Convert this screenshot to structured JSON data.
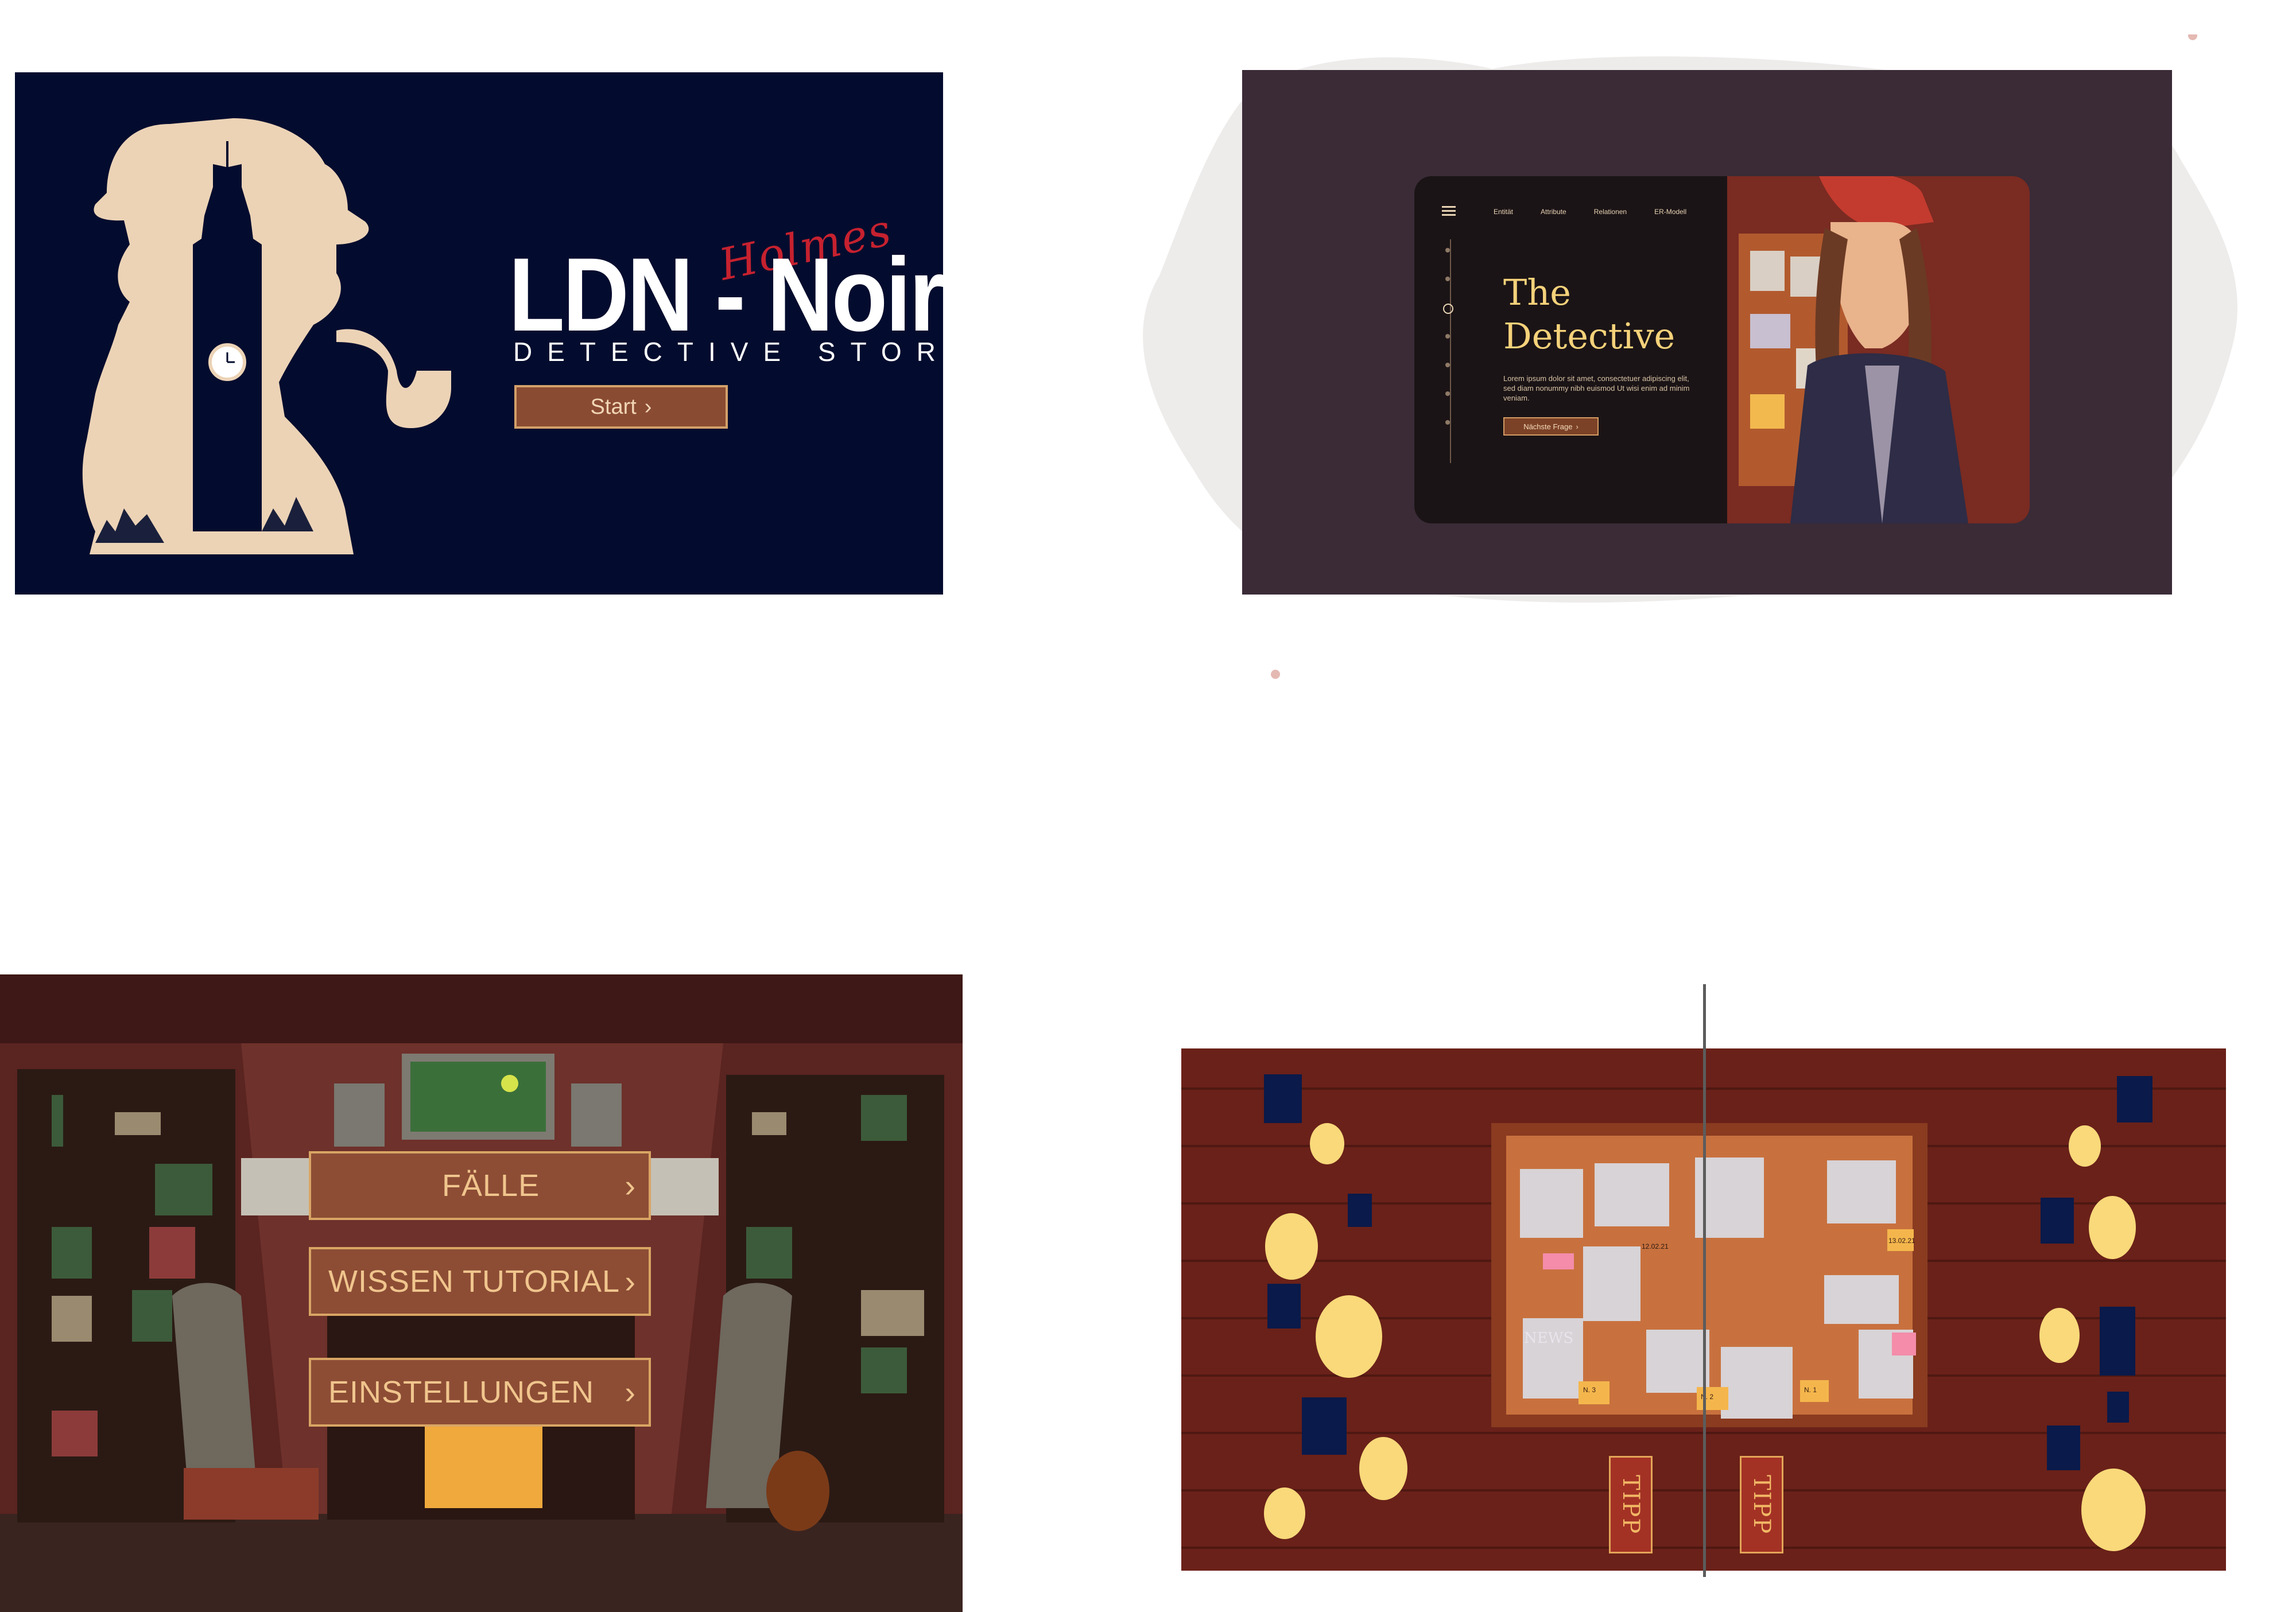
{
  "panel1": {
    "holmes_script": "Holmes",
    "title": "LDN - Noir",
    "subtitle": "DETECTIVE STORY",
    "start_button": "Start",
    "chevron": "›",
    "colors": {
      "background": "#030c2e",
      "silhouette": "#ecd3b6",
      "accent": "#c6212f",
      "button": "#8a4b33"
    }
  },
  "panel2": {
    "nav": [
      "Entität",
      "Attribute",
      "Relationen",
      "ER-Modell"
    ],
    "hero_title_line1": "The",
    "hero_title_line2": "Detective",
    "hero_body": "Lorem ipsum dolor sit amet, consectetuer adipiscing elit, sed diam nonummy nibh euismod Ut wisi enim ad minim veniam.",
    "next_button": "Nächste Frage",
    "chevron": "›",
    "icons": [
      "menu-icon"
    ],
    "colors": {
      "frame": "#3a2b37",
      "card": "#1b1416",
      "title": "#f5d27a"
    }
  },
  "panel3": {
    "menu": [
      {
        "label": "FÄLLE"
      },
      {
        "label": "WISSEN TUTORIAL"
      },
      {
        "label": "EINSTELLUNGEN"
      }
    ],
    "chevron": "›",
    "colors": {
      "wall": "#3d1816",
      "button": "#8d4d35",
      "button_border": "#d9a564"
    }
  },
  "panel4": {
    "tipp_buttons": [
      "TIPP",
      "TIPP"
    ],
    "notes": [
      "N. 3",
      "N. 2",
      "N. 1",
      "N. 2",
      "12.02.21",
      "13.02.21",
      "NEWS"
    ],
    "colors": {
      "wall": "#6a2119",
      "board": "#b54f2a",
      "light": "#f9d97a",
      "marker": "#0a1a4a"
    }
  }
}
